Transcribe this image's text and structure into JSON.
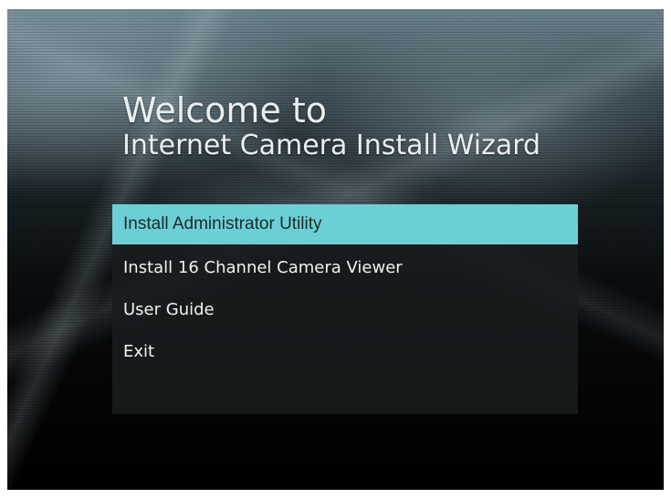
{
  "window": {
    "title_line1": "Welcome to",
    "title_line2": "Internet Camera Install Wizard"
  },
  "menu": {
    "selected_index": 0,
    "items": [
      {
        "label": "Install Administrator Utility"
      },
      {
        "label": "Install 16 Channel Camera Viewer"
      },
      {
        "label": "User Guide"
      },
      {
        "label": "Exit"
      }
    ]
  },
  "colors": {
    "highlight": "#6dcfd6",
    "panel": "#191c1e",
    "text": "#f2f2f2"
  }
}
